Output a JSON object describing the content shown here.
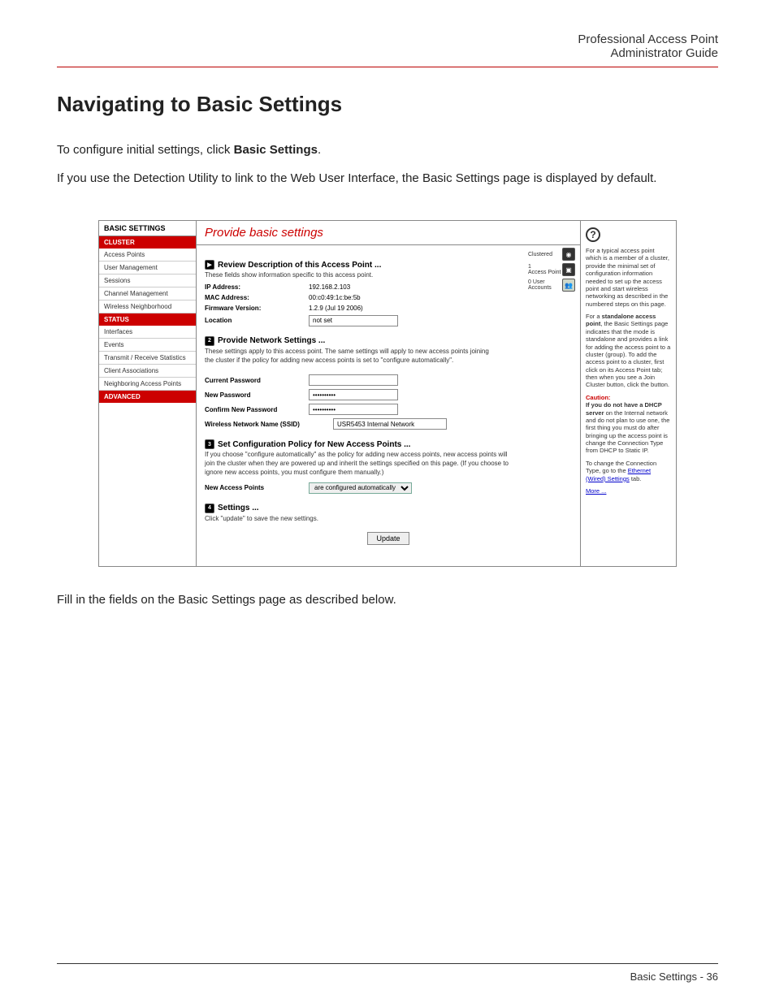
{
  "doc_header": {
    "line1": "Professional Access Point",
    "line2": "Administrator Guide"
  },
  "page_title": "Navigating to Basic Settings",
  "intro_p1_a": "To configure initial settings, click ",
  "intro_p1_b": "Basic Settings",
  "intro_p1_c": ".",
  "intro_p2": "If you use the Detection Utility to link to the Web User Interface, the Basic Settings page is displayed by default.",
  "outro": "Fill in the fields on the Basic Settings page as described below.",
  "footer": "Basic Settings - 36",
  "ss": {
    "sidebar": {
      "title": "BASIC SETTINGS",
      "cluster": "CLUSTER",
      "cluster_items": [
        "Access Points",
        "User Management",
        "Sessions",
        "Channel Management",
        "Wireless Neighborhood"
      ],
      "status": "STATUS",
      "status_items": [
        "Interfaces",
        "Events",
        "Transmit / Receive Statistics",
        "Client Associations",
        "Neighboring Access Points"
      ],
      "advanced": "ADVANCED"
    },
    "center": {
      "title": "Provide basic settings",
      "s1": {
        "head": "Review Description of this Access Point ...",
        "sub": "These fields show information specific to this access point.",
        "ip_l": "IP Address:",
        "ip_v": "192.168.2.103",
        "mac_l": "MAC Address:",
        "mac_v": "00:c0:49:1c:be:5b",
        "fw_l": "Firmware Version:",
        "fw_v": "1.2.9 (Jul 19 2006)",
        "loc_l": "Location",
        "loc_v": "not set"
      },
      "s2": {
        "head": "Provide Network Settings ...",
        "sub": "These settings apply to this access point. The same settings will apply to new access points joining the cluster if the policy for adding new access points is set to \"configure automatically\".",
        "cur_l": "Current Password",
        "new_l": "New Password",
        "conf_l": "Confirm New Password",
        "pw_mask": "••••••••••",
        "ssid_l": "Wireless Network Name (SSID)",
        "ssid_v": "USR5453 Internal Network"
      },
      "s3": {
        "head": "Set Configuration Policy for New Access Points ...",
        "sub": "If you choose \"configure automatically\" as the policy for adding new access points, new access points will join the cluster when they are powered up and inherit the settings specified on this page. (If you choose to ignore new access points, you must configure them manually.)",
        "nap_l": "New Access Points",
        "nap_v": "are configured automatically"
      },
      "s4": {
        "head": "Settings ...",
        "sub": "Click \"update\" to save the new settings.",
        "btn": "Update"
      },
      "badges": {
        "b1": "Clustered",
        "b2a": "1",
        "b2b": "Access Point",
        "b3a": "0 User",
        "b3b": "Accounts"
      }
    },
    "right": {
      "p1": "For a typical access point which is a member of a cluster, provide the minimal set of configuration information needed to set up the access point and start wireless networking as described in the numbered steps on this page.",
      "p2a": "For a ",
      "p2b": "standalone access point",
      "p2c": ", the Basic Settings page indicates that the mode is standalone and provides a link for adding the access point to a cluster (group). To add the access point to a cluster, first click on its Access Point tab; then when you see a Join Cluster button, click the button.",
      "caution_l": "Caution:",
      "p3a": "If you do not have a DHCP server",
      "p3b": " on the Internal network and do not plan to use one, the first thing you must do after bringing up the access point is change the Connection Type from DHCP to Static IP.",
      "p4a": "To change the Connection Type, go to the ",
      "p4b": "Ethernet (Wired) Settings",
      "p4c": " tab.",
      "more": "More ..."
    }
  }
}
